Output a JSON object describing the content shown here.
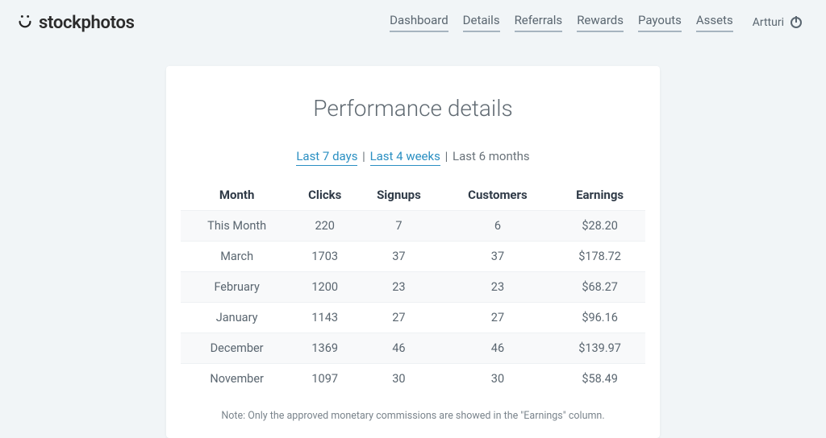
{
  "brand": {
    "name": "stockphotos"
  },
  "nav": {
    "items": [
      {
        "label": "Dashboard"
      },
      {
        "label": "Details"
      },
      {
        "label": "Referrals"
      },
      {
        "label": "Rewards"
      },
      {
        "label": "Payouts"
      },
      {
        "label": "Assets"
      }
    ],
    "user": "Artturi"
  },
  "card": {
    "title": "Performance details",
    "ranges": {
      "r0": "Last 7 days",
      "r1": "Last 4 weeks",
      "r2": "Last 6 months"
    },
    "footnote": "Note: Only the approved monetary commissions are showed in the \"Earnings\" column."
  },
  "table": {
    "headers": {
      "month": "Month",
      "clicks": "Clicks",
      "signups": "Signups",
      "customers": "Customers",
      "earnings": "Earnings"
    },
    "rows": [
      {
        "month": "This Month",
        "clicks": "220",
        "signups": "7",
        "customers": "6",
        "earnings": "$28.20"
      },
      {
        "month": "March",
        "clicks": "1703",
        "signups": "37",
        "customers": "37",
        "earnings": "$178.72"
      },
      {
        "month": "February",
        "clicks": "1200",
        "signups": "23",
        "customers": "23",
        "earnings": "$68.27"
      },
      {
        "month": "January",
        "clicks": "1143",
        "signups": "27",
        "customers": "27",
        "earnings": "$96.16"
      },
      {
        "month": "December",
        "clicks": "1369",
        "signups": "46",
        "customers": "46",
        "earnings": "$139.97"
      },
      {
        "month": "November",
        "clicks": "1097",
        "signups": "30",
        "customers": "30",
        "earnings": "$58.49"
      }
    ]
  }
}
